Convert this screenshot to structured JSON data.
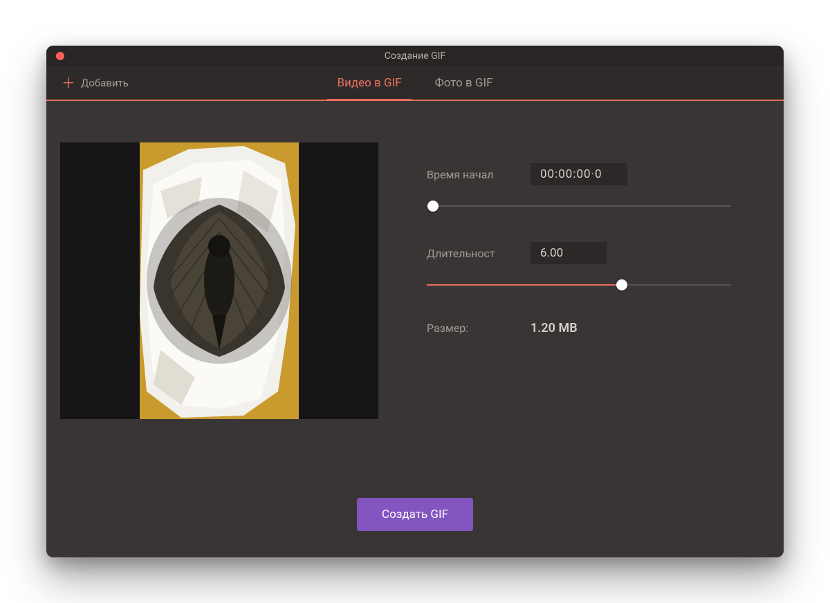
{
  "window": {
    "title": "Создание GIF"
  },
  "toolbar": {
    "add_label": "Добавить",
    "tabs": [
      {
        "label": "Видео в GIF",
        "active": true
      },
      {
        "label": "Фото в GIF",
        "active": false
      }
    ]
  },
  "controls": {
    "start_label": "Время начал",
    "start_value": "00:00:00·0",
    "start_progress": 0.02,
    "duration_label": "Длительност",
    "duration_value": "6.00",
    "duration_progress": 0.64,
    "size_label": "Размер:",
    "size_value": "1.20 MB"
  },
  "footer": {
    "create_label": "Создать GIF"
  },
  "colors": {
    "accent": "#e86f5e",
    "primary_button": "#8355c0"
  }
}
